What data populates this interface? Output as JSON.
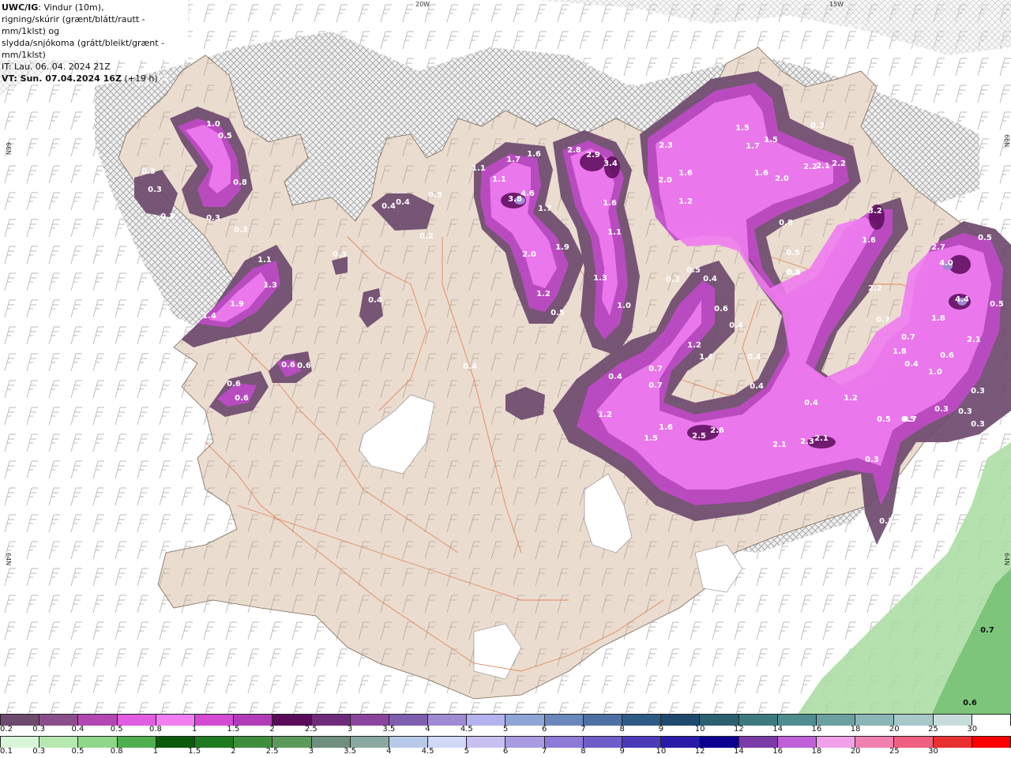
{
  "info": {
    "model_label": "UWC/IG",
    "line1_rest": ": Vindur (10m),",
    "line2": "rigning/skúrir (grænt/blátt/rautt - mm/1klst) og",
    "line3": "slydda/snjókoma (grátt/bleikt/grænt - mm/1klst)",
    "line4": "IT: Lau. 06. 04. 2024 21Z",
    "line5_bold": "VT: Sun. 07.04.2024 16Z",
    "line5_rest": " (+19 h)"
  },
  "grid_labels": [
    "20W",
    "15W",
    "66N",
    "66N",
    "64N",
    "64N"
  ],
  "map_values": [
    "0.2",
    "0.3",
    "0.2",
    "0.3",
    "1.0",
    "0.5",
    "0.3",
    "0.3",
    "0.8",
    "0.3",
    "0.3",
    "0.3",
    "0.4",
    "0.4",
    "0.4",
    "0.2",
    "0.3",
    "1.1",
    "1.3",
    "1.9",
    "1.4",
    "0.4",
    "0.6",
    "0.6",
    "0.6",
    "0.6",
    "1.1",
    "1.7",
    "1.6",
    "1.1",
    "3.8",
    "4.6",
    "1.7",
    "2.0",
    "1.9",
    "1.2",
    "0.5",
    "2.8",
    "2.9",
    "3.4",
    "1.6",
    "1.1",
    "1.3",
    "1.0",
    "2.3",
    "2.0",
    "1.6",
    "1.2",
    "1.5",
    "1.7",
    "1.5",
    "1.6",
    "2.0",
    "2.2",
    "2.1",
    "2.2",
    "0.3",
    "0.8",
    "0.5",
    "0.6",
    "0.3",
    "0.5",
    "0.4",
    "0.6",
    "0.4",
    "1.2",
    "1.4",
    "0.4",
    "0.7",
    "0.7",
    "0.4",
    "0.4",
    "0.4",
    "0.3",
    "1.2",
    "1.5",
    "1.6",
    "2.5",
    "2.6",
    "2.1",
    "2.3",
    "2.1",
    "3.2",
    "1.6",
    "2.2",
    "0.7",
    "0.7",
    "1.8",
    "0.4",
    "1.2",
    "0.5",
    "0.7",
    "2.7",
    "4.0",
    "4.4",
    "1.8",
    "2.1",
    "0.6",
    "0.4",
    "1.0",
    "0.3",
    "0.3",
    "0.3",
    "0.3",
    "0.4",
    "0.5",
    "0.5",
    "0.5",
    "0.3",
    "0.3",
    "0.7",
    "0.6"
  ],
  "colorbar_snow": {
    "labels": [
      "0.2",
      "0.3",
      "0.4",
      "0.5",
      "0.8",
      "1",
      "1.5",
      "2",
      "2.5",
      "3",
      "3.5",
      "4",
      "4.5",
      "5",
      "6",
      "7",
      "8",
      "9",
      "10",
      "12",
      "14",
      "16",
      "18",
      "20",
      "25",
      "30"
    ],
    "colors": [
      "#6e4a6e",
      "#8a4f8a",
      "#b347b3",
      "#e05ce0",
      "#f37df3",
      "#d24bd2",
      "#b13bb8",
      "#5a0b5a",
      "#6e2b7a",
      "#8a449e",
      "#7e5fb0",
      "#a08ad4",
      "#b3b3f0",
      "#8fa5d6",
      "#6b88bd",
      "#4d6fa3",
      "#2e5a86",
      "#1f4a6e",
      "#2b6070",
      "#3d7a80",
      "#4e8c8f",
      "#6ba0a0",
      "#8cb6b6",
      "#a8c8c8",
      "#c8dcdc",
      "#ffffff"
    ]
  },
  "colorbar_rain": {
    "labels": [
      "0.1",
      "0.3",
      "0.5",
      "0.8",
      "1",
      "1.5",
      "2",
      "2.5",
      "3",
      "3.5",
      "4",
      "4.5",
      "5",
      "6",
      "7",
      "8",
      "9",
      "10",
      "12",
      "14",
      "16",
      "18",
      "20",
      "25",
      "30"
    ],
    "colors": [
      "#d8f5d8",
      "#b6e8b0",
      "#8fd68a",
      "#4fae4f",
      "#0b5a0b",
      "#1e7a1e",
      "#3e8e3e",
      "#5c9a5c",
      "#6f8f7f",
      "#8aa8a0",
      "#b8c8e8",
      "#d0d8f5",
      "#c8c0f0",
      "#a89be0",
      "#8c7ad6",
      "#6e5cc8",
      "#4a3ab8",
      "#2a1aa8",
      "#0a0090",
      "#7a3aa8",
      "#c060d8",
      "#f0a0e8",
      "#f080b0",
      "#f06080",
      "#e83030",
      "#ff0000"
    ]
  }
}
